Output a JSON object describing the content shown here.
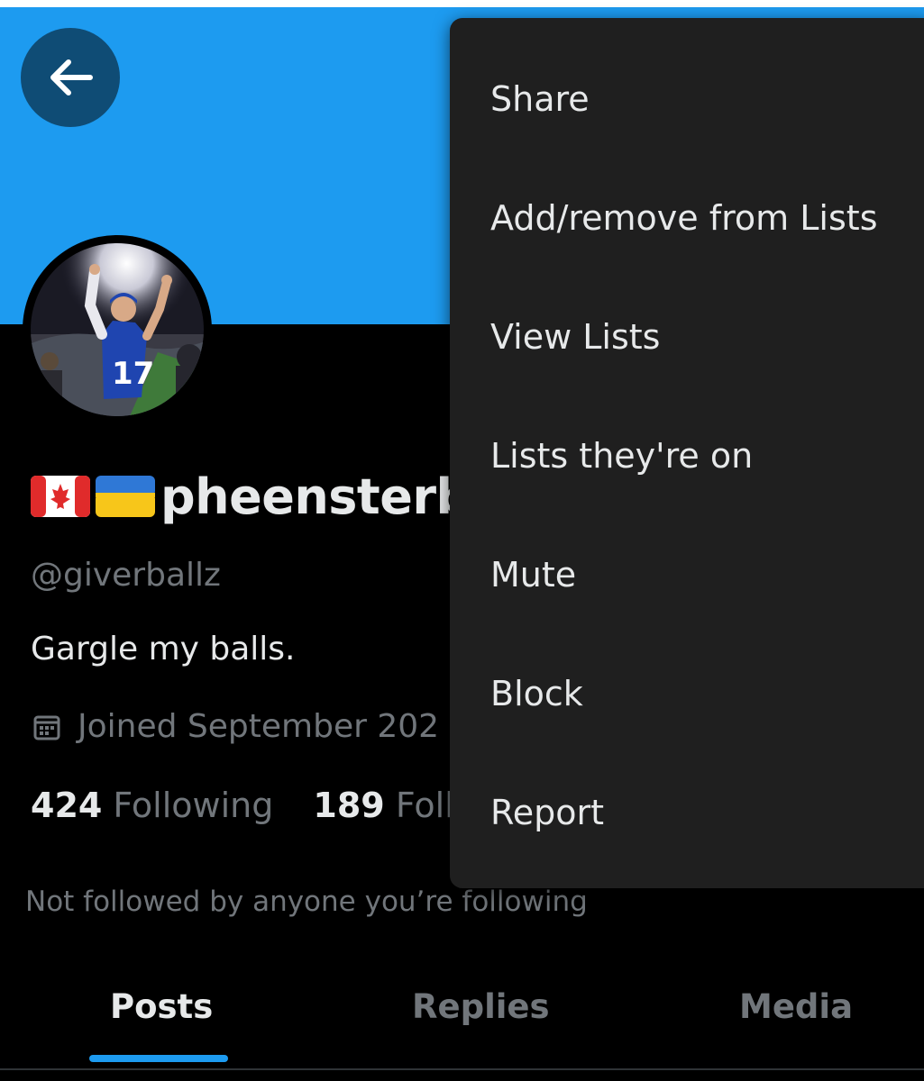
{
  "profile": {
    "display_name": "pheensterb",
    "flags": [
      "canada-flag-icon",
      "ukraine-flag-icon"
    ],
    "handle": "@giverballz",
    "bio": "Gargle my balls.",
    "joined": "Joined September 202",
    "following_count": "424",
    "following_label": "Following",
    "followers_count": "189",
    "followers_label": "Foll",
    "not_followed_text": "Not followed by anyone you’re following"
  },
  "tabs": [
    {
      "label": "Posts",
      "active": true
    },
    {
      "label": "Replies",
      "active": false
    },
    {
      "label": "Media",
      "active": false
    }
  ],
  "menu": {
    "items": [
      {
        "label": "Share"
      },
      {
        "label": "Add/remove from Lists"
      },
      {
        "label": "View Lists"
      },
      {
        "label": "Lists they're on"
      },
      {
        "label": "Mute"
      },
      {
        "label": "Block"
      },
      {
        "label": "Report"
      }
    ]
  },
  "colors": {
    "banner": "#1d9bf0",
    "accent": "#1d9bf0",
    "menu_background": "#1f1f1f",
    "page_background": "#000000",
    "primary_text": "#e7e9ea",
    "secondary_text": "#71767b"
  },
  "icons": {
    "back": "arrow-left-icon",
    "joined": "calendar-icon"
  }
}
